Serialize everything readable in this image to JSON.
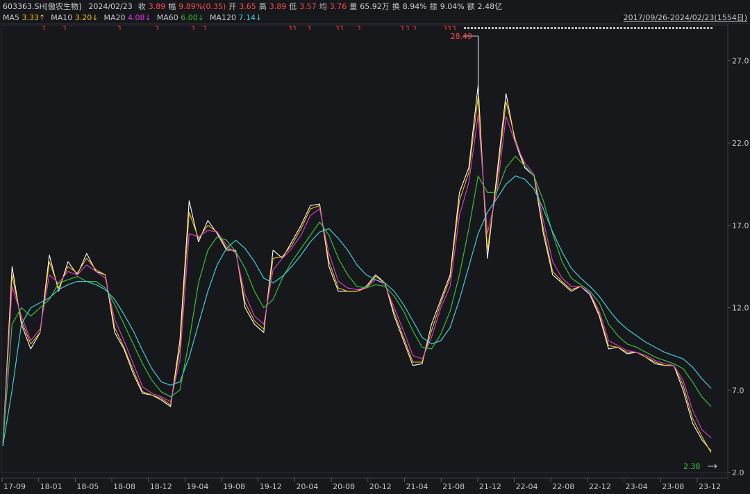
{
  "header": {
    "code": "603363.SH[傲农生物]",
    "date": "2024/02/23",
    "close_label": "收",
    "close": "3.89",
    "change_label": "幅",
    "change": "9.89%(0.35)",
    "open_label": "开",
    "open": "3.65",
    "high_label": "高",
    "high": "3.89",
    "low_label": "低",
    "low": "3.57",
    "avg_label": "均",
    "avg": "3.76",
    "volume_label": "量",
    "volume": "65.92万",
    "turnover_label": "换",
    "turnover": "8.94%",
    "amplitude_label": "振",
    "amplitude": "9.04%",
    "amount_label": "额",
    "amount": "2.48亿"
  },
  "ma_legend": [
    {
      "name": "MA5",
      "value": "3.33↑",
      "color": "#ffffff"
    },
    {
      "name": "MA10",
      "value": "3.20↓",
      "color": "#f2c200"
    },
    {
      "name": "MA20",
      "value": "4.08↓",
      "color": "#e03ce0"
    },
    {
      "name": "MA60",
      "value": "6.00↓",
      "color": "#36c236"
    },
    {
      "name": "MA120",
      "value": "7.14↓",
      "color": "#3fd0d8"
    }
  ],
  "range_text": "2017/09/26-2024/02/23(1554日)",
  "annotations": {
    "max_label": "28.49",
    "min_label": "2.38"
  },
  "chart_data": {
    "type": "line",
    "y_ticks": [
      "27.0",
      "22.0",
      "17.0",
      "12.0",
      "7.0",
      "2.0"
    ],
    "ylim": [
      2.0,
      28.49
    ],
    "x_ticks": [
      "17-09",
      "18-01",
      "18-05",
      "18-08",
      "18-12",
      "19-04",
      "19-08",
      "19-12",
      "20-04",
      "20-08",
      "20-12",
      "21-04",
      "21-08",
      "21-12",
      "22-04",
      "22-08",
      "22-12",
      "23-04",
      "23-08",
      "23-12"
    ],
    "x_index": [
      0,
      1,
      2,
      3,
      4,
      5,
      6,
      7,
      8,
      9,
      10,
      11,
      12,
      13,
      14,
      15,
      16,
      17,
      18,
      19,
      20,
      21,
      22,
      23,
      24,
      25,
      26,
      27,
      28,
      29,
      30,
      31,
      32,
      33,
      34,
      35,
      36,
      37,
      38,
      39,
      40,
      41,
      42,
      43,
      44,
      45,
      46,
      47,
      48,
      49,
      50,
      51,
      52,
      53,
      54,
      55,
      56,
      57,
      58,
      59,
      60,
      61,
      62,
      63,
      64,
      65,
      66,
      67,
      68,
      69,
      70,
      71,
      72,
      73,
      74,
      75,
      76
    ],
    "series": [
      {
        "name": "MA5",
        "color": "#ffffff",
        "values": [
          3.6,
          14.5,
          11.0,
          9.5,
          10.5,
          15.2,
          13.0,
          14.8,
          14.0,
          15.3,
          14.2,
          14.0,
          10.5,
          9.5,
          8.0,
          6.8,
          6.7,
          6.4,
          6.0,
          10.0,
          18.5,
          16.0,
          17.3,
          16.5,
          15.5,
          15.5,
          12.0,
          11.0,
          10.5,
          15.5,
          15.0,
          16.0,
          17.0,
          18.2,
          18.3,
          14.5,
          13.0,
          13.0,
          13.0,
          13.3,
          14.0,
          13.5,
          11.5,
          10.0,
          8.5,
          8.6,
          11.0,
          12.5,
          14.0,
          19.0,
          20.5,
          25.5,
          15.0,
          20.0,
          25.0,
          22.0,
          20.5,
          20.0,
          16.5,
          14.0,
          13.5,
          13.0,
          13.3,
          12.8,
          11.5,
          9.5,
          9.6,
          9.2,
          9.3,
          9.0,
          8.6,
          8.5,
          8.5,
          7.0,
          5.0,
          4.0,
          3.3
        ]
      },
      {
        "name": "MA10",
        "color": "#f2c200",
        "values": [
          3.6,
          14.0,
          11.2,
          9.8,
          10.5,
          14.8,
          13.2,
          14.5,
          14.1,
          15.0,
          14.3,
          14.0,
          10.8,
          9.6,
          8.2,
          6.9,
          6.7,
          6.5,
          6.1,
          9.5,
          17.8,
          16.2,
          17.0,
          16.6,
          15.6,
          15.4,
          12.3,
          11.2,
          10.7,
          15.0,
          15.1,
          15.8,
          16.8,
          18.0,
          18.2,
          14.8,
          13.2,
          13.0,
          13.0,
          13.2,
          13.9,
          13.5,
          11.7,
          10.2,
          8.7,
          8.7,
          10.6,
          12.3,
          13.8,
          18.5,
          20.2,
          24.8,
          15.5,
          19.6,
          24.5,
          22.2,
          20.6,
          20.0,
          16.8,
          14.2,
          13.6,
          13.1,
          13.3,
          12.9,
          11.6,
          9.7,
          9.6,
          9.3,
          9.3,
          9.0,
          8.7,
          8.5,
          8.5,
          7.3,
          5.3,
          4.2,
          3.2
        ]
      },
      {
        "name": "MA20",
        "color": "#e03ce0",
        "values": [
          3.6,
          13.3,
          11.5,
          10.0,
          10.7,
          14.0,
          13.5,
          14.2,
          14.0,
          14.6,
          14.2,
          13.8,
          11.3,
          10.0,
          8.6,
          7.2,
          6.8,
          6.6,
          6.3,
          8.8,
          16.5,
          16.3,
          16.7,
          16.6,
          15.8,
          15.3,
          12.8,
          11.5,
          11.0,
          14.3,
          15.0,
          15.6,
          16.4,
          17.6,
          18.0,
          15.3,
          13.6,
          13.2,
          13.1,
          13.2,
          13.7,
          13.4,
          12.0,
          10.6,
          9.1,
          8.9,
          10.2,
          12.0,
          13.3,
          17.6,
          19.6,
          23.7,
          16.5,
          19.0,
          23.6,
          22.0,
          20.8,
          20.1,
          17.3,
          14.8,
          13.8,
          13.3,
          13.3,
          12.9,
          11.8,
          10.0,
          9.7,
          9.4,
          9.3,
          9.1,
          8.8,
          8.6,
          8.5,
          7.6,
          5.8,
          4.6,
          4.1
        ]
      },
      {
        "name": "MA60",
        "color": "#36c236",
        "values": [
          3.6,
          11.0,
          12.0,
          11.5,
          12.0,
          12.5,
          13.5,
          13.7,
          13.9,
          13.6,
          13.6,
          13.2,
          12.2,
          11.0,
          9.8,
          8.6,
          7.6,
          6.9,
          6.6,
          7.0,
          10.0,
          13.5,
          15.5,
          16.3,
          16.1,
          15.4,
          14.4,
          13.0,
          12.0,
          12.5,
          13.8,
          14.8,
          15.6,
          16.4,
          17.2,
          16.4,
          15.0,
          14.0,
          13.3,
          13.2,
          13.4,
          13.3,
          12.7,
          11.8,
          10.6,
          9.6,
          9.5,
          10.4,
          11.8,
          14.0,
          16.8,
          20.0,
          19.0,
          19.0,
          20.5,
          21.2,
          20.6,
          20.0,
          18.5,
          16.5,
          14.8,
          13.8,
          13.4,
          13.0,
          12.3,
          11.0,
          10.3,
          9.8,
          9.6,
          9.3,
          9.0,
          8.8,
          8.6,
          8.3,
          7.5,
          6.6,
          6.0
        ]
      },
      {
        "name": "MA120",
        "color": "#3fd0d8",
        "values": [
          3.6,
          7.0,
          11.0,
          12.0,
          12.3,
          12.6,
          13.1,
          13.4,
          13.6,
          13.6,
          13.4,
          13.1,
          12.5,
          11.6,
          10.6,
          9.4,
          8.3,
          7.5,
          7.3,
          7.5,
          9.0,
          11.0,
          13.0,
          14.6,
          15.6,
          16.1,
          15.6,
          14.8,
          13.8,
          13.5,
          13.9,
          14.5,
          15.2,
          16.0,
          16.6,
          16.8,
          16.2,
          15.5,
          14.6,
          14.0,
          13.7,
          13.5,
          13.0,
          12.2,
          11.2,
          10.2,
          9.8,
          10.0,
          10.8,
          12.5,
          14.5,
          16.5,
          17.8,
          18.6,
          19.5,
          20.0,
          19.8,
          19.2,
          18.0,
          16.6,
          15.4,
          14.4,
          13.8,
          13.3,
          12.7,
          11.9,
          11.2,
          10.7,
          10.3,
          9.9,
          9.6,
          9.3,
          9.1,
          8.9,
          8.4,
          7.7,
          7.1
        ]
      }
    ]
  }
}
